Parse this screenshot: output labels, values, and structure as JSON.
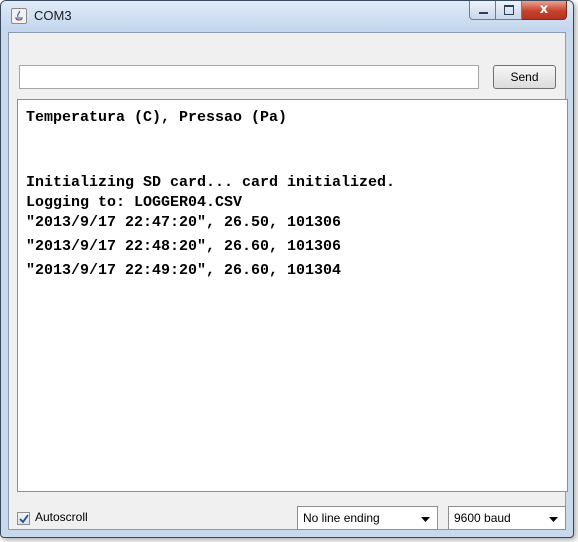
{
  "window": {
    "title": "COM3",
    "close_glyph": "x",
    "icons": [
      "java-app-icon",
      "minimize-icon",
      "maximize-icon",
      "close-icon"
    ]
  },
  "send": {
    "input_value": "",
    "button_label": "Send"
  },
  "output": {
    "lines": [
      "Temperatura (C), Pressao (Pa)",
      "",
      "",
      "Initializing SD card... card initialized.",
      "Logging to: LOGGER04.CSV",
      "\"2013/9/17 22:47:20\", 26.50, 101306",
      "\"2013/9/17 22:48:20\", 26.60, 101306",
      "\"2013/9/17 22:49:20\", 26.60, 101304"
    ]
  },
  "footer": {
    "autoscroll_label": "Autoscroll",
    "autoscroll_checked": true,
    "line_ending": "No line ending",
    "baud_rate": "9600 baud"
  },
  "colors": {
    "title_bar": "#c3d6ee",
    "close_button": "#c7422b",
    "console_text": "#000000"
  }
}
